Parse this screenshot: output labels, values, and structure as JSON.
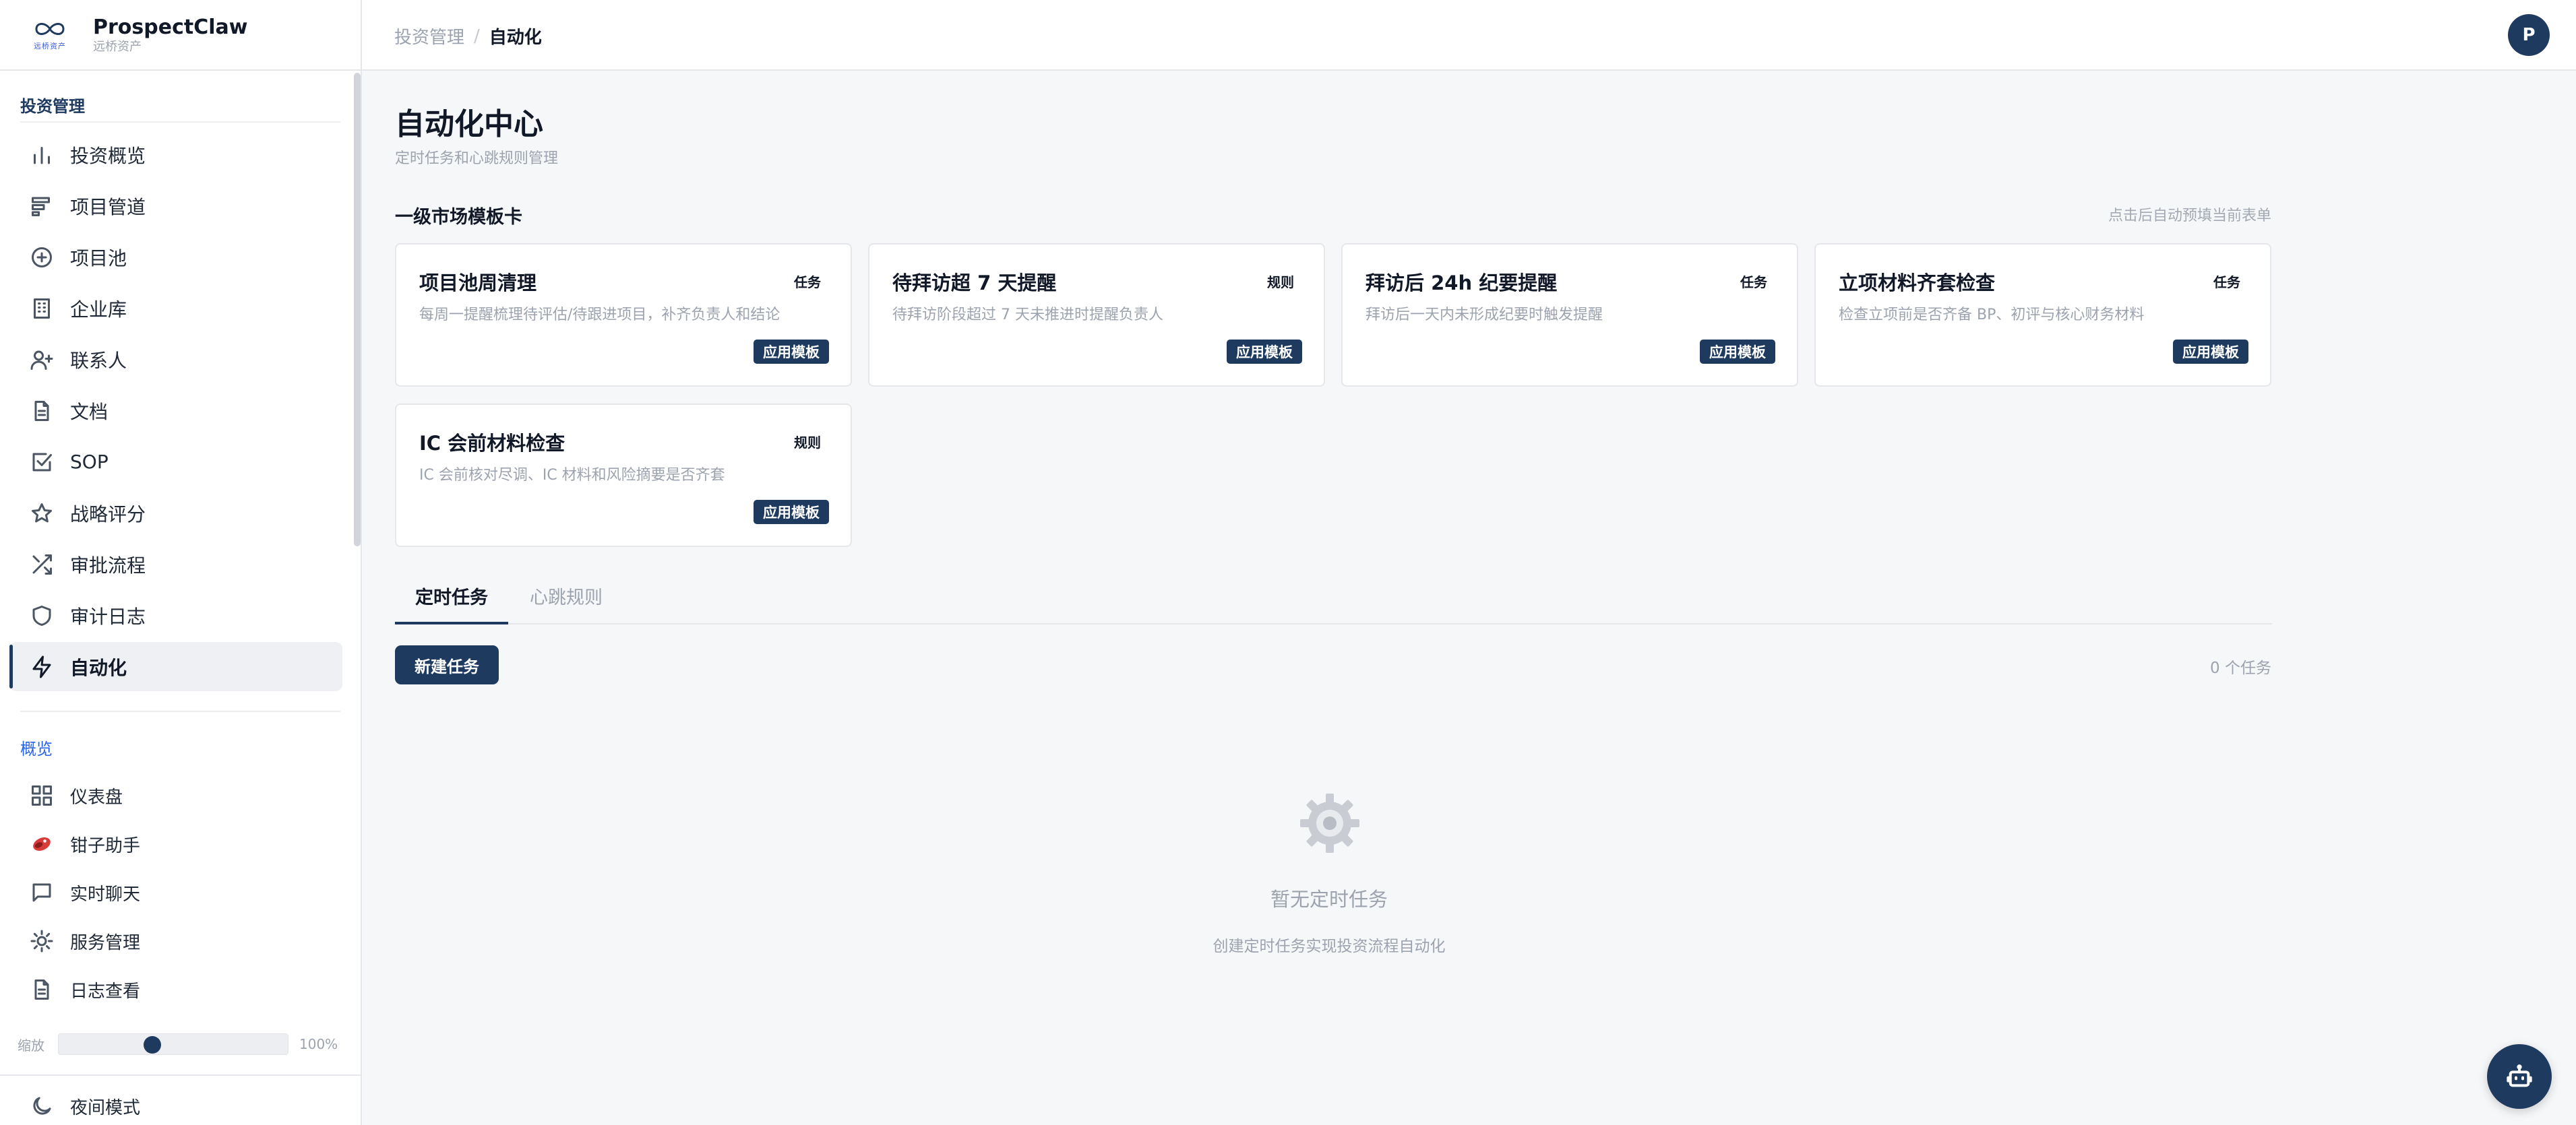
{
  "brand": {
    "name": "ProspectClaw",
    "subtitle": "远桥资产",
    "logo_text": "远桥资产"
  },
  "sidebar": {
    "section1_label": "投资管理",
    "items": [
      {
        "label": "投资概览",
        "icon": "bar-chart-icon"
      },
      {
        "label": "项目管道",
        "icon": "pipeline-icon"
      },
      {
        "label": "项目池",
        "icon": "plus-circle-icon"
      },
      {
        "label": "企业库",
        "icon": "building-icon"
      },
      {
        "label": "联系人",
        "icon": "user-plus-icon"
      },
      {
        "label": "文档",
        "icon": "document-icon"
      },
      {
        "label": "SOP",
        "icon": "check-square-icon"
      },
      {
        "label": "战略评分",
        "icon": "star-icon"
      },
      {
        "label": "审批流程",
        "icon": "shuffle-icon"
      },
      {
        "label": "审计日志",
        "icon": "shield-icon"
      },
      {
        "label": "自动化",
        "icon": "lightning-icon"
      }
    ],
    "section2_label": "概览",
    "items2": [
      {
        "label": "仪表盘",
        "icon": "grid-icon"
      },
      {
        "label": "钳子助手",
        "icon": "claw-icon"
      },
      {
        "label": "实时聊天",
        "icon": "chat-icon"
      },
      {
        "label": "服务管理",
        "icon": "sun-gear-icon"
      },
      {
        "label": "日志查看",
        "icon": "document-icon"
      }
    ],
    "zoom": {
      "label": "缩放",
      "value_text": "100%",
      "fraction": 0.4
    },
    "night_mode": "夜间模式"
  },
  "header": {
    "breadcrumb_parent": "投资管理",
    "breadcrumb_sep": "/",
    "breadcrumb_current": "自动化",
    "avatar_letter": "P"
  },
  "main": {
    "title": "自动化中心",
    "subtitle": "定时任务和心跳规则管理",
    "templates_title": "一级市场模板卡",
    "templates_hint": "点击后自动预填当前表单",
    "cards": [
      {
        "title": "项目池周清理",
        "badge": "任务",
        "desc": "每周一提醒梳理待评估/待跟进项目，补齐负责人和结论",
        "button": "应用模板"
      },
      {
        "title": "待拜访超 7 天提醒",
        "badge": "规则",
        "desc": "待拜访阶段超过 7 天未推进时提醒负责人",
        "button": "应用模板"
      },
      {
        "title": "拜访后 24h 纪要提醒",
        "badge": "任务",
        "desc": "拜访后一天内未形成纪要时触发提醒",
        "button": "应用模板"
      },
      {
        "title": "立项材料齐套检查",
        "badge": "任务",
        "desc": "检查立项前是否齐备 BP、初评与核心财务材料",
        "button": "应用模板"
      },
      {
        "title": "IC 会前材料检查",
        "badge": "规则",
        "desc": "IC 会前核对尽调、IC 材料和风险摘要是否齐套",
        "button": "应用模板"
      }
    ],
    "tabs": [
      {
        "label": "定时任务"
      },
      {
        "label": "心跳规则"
      }
    ],
    "new_button": "新建任务",
    "task_count": "0 个任务",
    "empty_title": "暂无定时任务",
    "empty_subtitle": "创建定时任务实现投资流程自动化"
  },
  "colors": {
    "accent": "#1e3a5f",
    "link": "#2563eb",
    "muted": "#9ca3af",
    "background": "#f6f7f9"
  }
}
